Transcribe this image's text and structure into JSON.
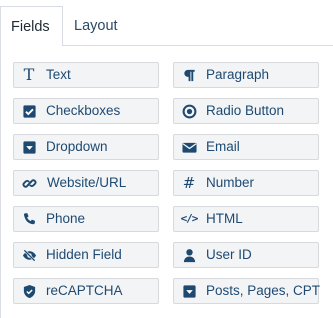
{
  "tabs": [
    {
      "label": "Fields",
      "active": true
    },
    {
      "label": "Layout",
      "active": false
    }
  ],
  "fields": [
    {
      "label": "Text",
      "icon": "text-t-icon"
    },
    {
      "label": "Paragraph",
      "icon": "pilcrow-icon"
    },
    {
      "label": "Checkboxes",
      "icon": "checkbox-icon"
    },
    {
      "label": "Radio Button",
      "icon": "radio-button-icon"
    },
    {
      "label": "Dropdown",
      "icon": "dropdown-icon"
    },
    {
      "label": "Email",
      "icon": "envelope-icon"
    },
    {
      "label": "Website/URL",
      "icon": "link-icon"
    },
    {
      "label": "Number",
      "icon": "hash-icon"
    },
    {
      "label": "Phone",
      "icon": "phone-icon"
    },
    {
      "label": "HTML",
      "icon": "code-icon"
    },
    {
      "label": "Hidden Field",
      "icon": "eye-slash-icon"
    },
    {
      "label": "User ID",
      "icon": "user-icon"
    },
    {
      "label": "reCAPTCHA",
      "icon": "shield-icon"
    },
    {
      "label": "Posts, Pages, CPT",
      "icon": "dropdown-icon"
    }
  ],
  "colors": {
    "accent": "#1e4a72",
    "button_bg": "#f3f4f5",
    "border": "#d7d9dc"
  }
}
